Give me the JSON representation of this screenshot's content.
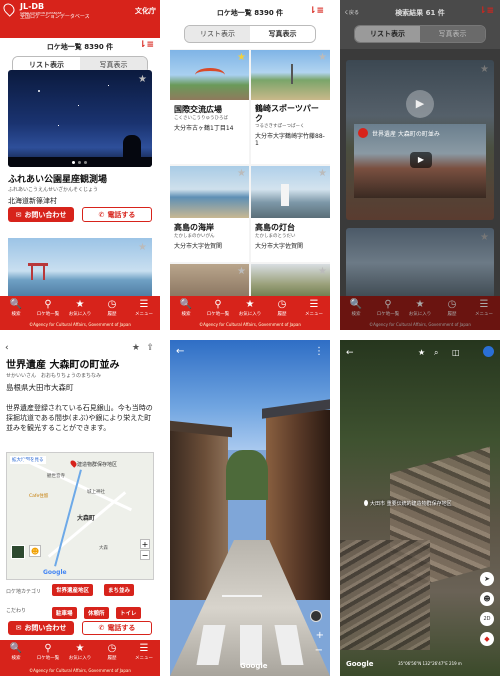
{
  "colors": {
    "brand_red": "#d7231b",
    "grey_bg": "#3a3a3a"
  },
  "p1": {
    "logo_line1": "JL-DB",
    "logo_line2": "JAPAN LOCATION DATABASE",
    "logo_line3": "全国ロケーションデータベース",
    "badge": "文化庁",
    "header_title": "ロケ地一覧 8390 件",
    "tab_list": "リスト表示",
    "tab_photo": "写真表示",
    "card_title": "ふれあい公園星座観測場",
    "card_kana": "ふれあいこうえんせいざかんそくじょう",
    "card_address": "北海道新篠津村",
    "btn_contact": "お問い合わせ",
    "btn_call": "電話する"
  },
  "p2": {
    "header_title": "ロケ地一覧 8390 件",
    "tab_list": "リスト表示",
    "tab_photo": "写真表示",
    "items": [
      {
        "title": "国際交流広場",
        "kana": "こくさいこうりゅうひろば",
        "address": "大分市古ヶ鶴1丁目14"
      },
      {
        "title": "鶴崎スポーツパーク",
        "kana": "つるさきすぽーつぱーく",
        "address": "大分市大字鶴崎字竹藤88-1"
      },
      {
        "title": "高島の海岸",
        "kana": "たかしまのかいがん",
        "address": "大分市大字佐賀関"
      },
      {
        "title": "高島の灯台",
        "kana": "たかしまのとうだい",
        "address": "大分市大字佐賀関"
      }
    ]
  },
  "p3": {
    "back": "く戻る",
    "header_title": "検索結果 61 件",
    "tab_list": "リスト表示",
    "tab_photo": "写真表示",
    "video_title": "世界遺産 大森町の町並み"
  },
  "nav": {
    "items": [
      {
        "icon": "search-icon",
        "glyph": "🔍",
        "label": "検索"
      },
      {
        "icon": "pin-icon",
        "glyph": "⚲",
        "label": "ロケ地一覧"
      },
      {
        "icon": "star-icon",
        "glyph": "★",
        "label": "お気に入り"
      },
      {
        "icon": "history-icon",
        "glyph": "◷",
        "label": "履歴"
      },
      {
        "icon": "menu-icon",
        "glyph": "☰",
        "label": "メニュー"
      }
    ],
    "copyright": "©Agency for Cultural Affairs, Government of Japan"
  },
  "p4": {
    "title": "世界遺産 大森町の町並み",
    "kana": "せかいいさん　おおもりちょうのまちなみ",
    "address": "島根県大田市大森町",
    "description": "世界遺産登録されている石見銀山。今も当時の採掘坑道である間歩(まぶ)や銀により栄えた町並みを観光することができます。",
    "map_label": "建造物群保存地区",
    "map_expand": "拡大地図を見る",
    "map_places": [
      "観世音寺",
      "Cafe住留",
      "城上神社",
      "大森町",
      "大森"
    ],
    "category_label": "ロケ地カテゴリ",
    "tags1": [
      "世界遺産地区",
      "まち並み"
    ],
    "kodawari_label": "こだわり",
    "tags2": [
      "駐車場",
      "休憩所",
      "トイレ"
    ],
    "btn_contact": "お問い合わせ",
    "btn_call": "電話する"
  },
  "p6": {
    "address_overlay": "大田市 重要伝統的建造物群保存地区",
    "coords": "35°06'56\"N 132°26'47\"E 219 m",
    "google": "Google"
  },
  "p5": {
    "google": "Google"
  }
}
